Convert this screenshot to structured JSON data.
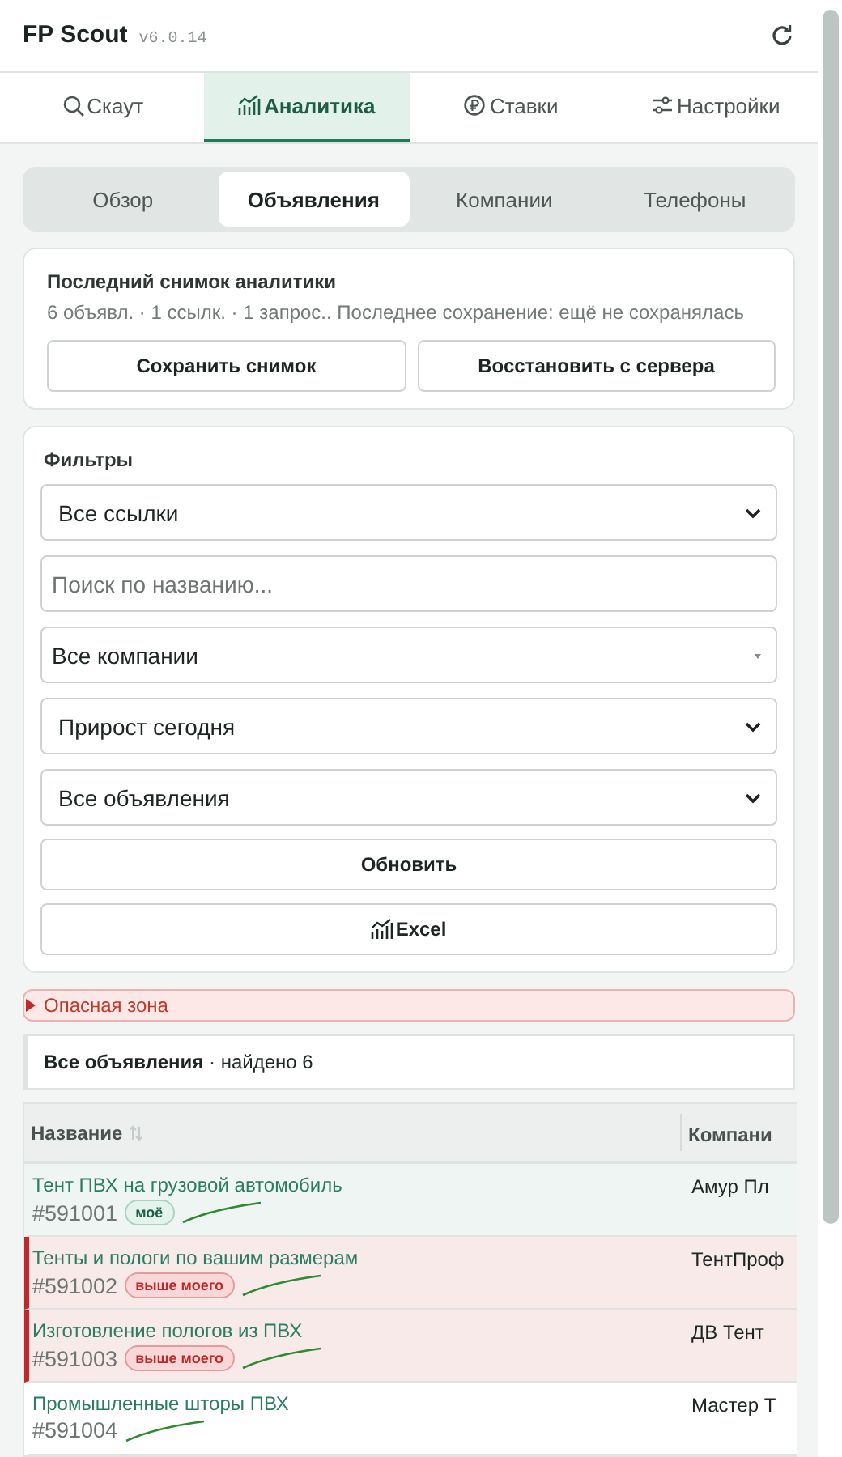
{
  "header": {
    "title": "FP Scout",
    "version": "v6.0.14"
  },
  "nav_tabs": [
    {
      "label": "Скаут",
      "selected": false
    },
    {
      "label": "Аналитика",
      "selected": true
    },
    {
      "label": "Ставки",
      "selected": false
    },
    {
      "label": "Настройки",
      "selected": false
    }
  ],
  "sub_tabs": [
    {
      "label": "Обзор",
      "selected": false
    },
    {
      "label": "Объявления",
      "selected": true
    },
    {
      "label": "Компании",
      "selected": false
    },
    {
      "label": "Телефоны",
      "selected": false
    }
  ],
  "snapshot": {
    "title": "Последний снимок аналитики",
    "summary": "6 объявл. · 1 ссылк. · 1 запрос.. Последнее сохранение: ещё не сохранялась",
    "buttons": [
      "Сохранить снимок",
      "Восстановить с сервера"
    ]
  },
  "filters": {
    "title": "Фильтры",
    "controls": [
      {
        "kind": "select",
        "value": "Все ссылки"
      },
      {
        "kind": "search",
        "placeholder": "Поиск по названию..."
      },
      {
        "kind": "combo",
        "value": "Все компании"
      },
      {
        "kind": "select",
        "value": "Прирост сегодня"
      },
      {
        "kind": "select",
        "value": "Все объявления"
      },
      {
        "kind": "button",
        "label": "Обновить"
      },
      {
        "kind": "export",
        "label": "Excel"
      }
    ]
  },
  "danger_zone": {
    "label": "Опасная зона",
    "expanded": false
  },
  "results": {
    "text": "**Все объявления** · найдено 6"
  },
  "table": {
    "columns": [
      {
        "label": "Название",
        "sortable": true
      },
      {
        "label": "Компани",
        "sortable": false
      }
    ],
    "rows": [
      {
        "kind": "mine",
        "name": "Тент ПВХ на грузовой автомобиль",
        "id": "#591001",
        "badge": "моё",
        "company": "Амур Пл"
      },
      {
        "kind": "above",
        "name": "Тенты и пологи по вашим размерам",
        "id": "#591002",
        "badge": "выше моего",
        "company": "ТентПроф"
      },
      {
        "kind": "above",
        "name": "Изготовление пологов из ПВХ",
        "id": "#591003",
        "badge": "выше моего",
        "company": "ДВ Тент"
      },
      {
        "kind": "plain",
        "name": "Промышленные шторы ПВХ",
        "id": "#591004",
        "company": "Мастер Т"
      }
    ]
  }
}
